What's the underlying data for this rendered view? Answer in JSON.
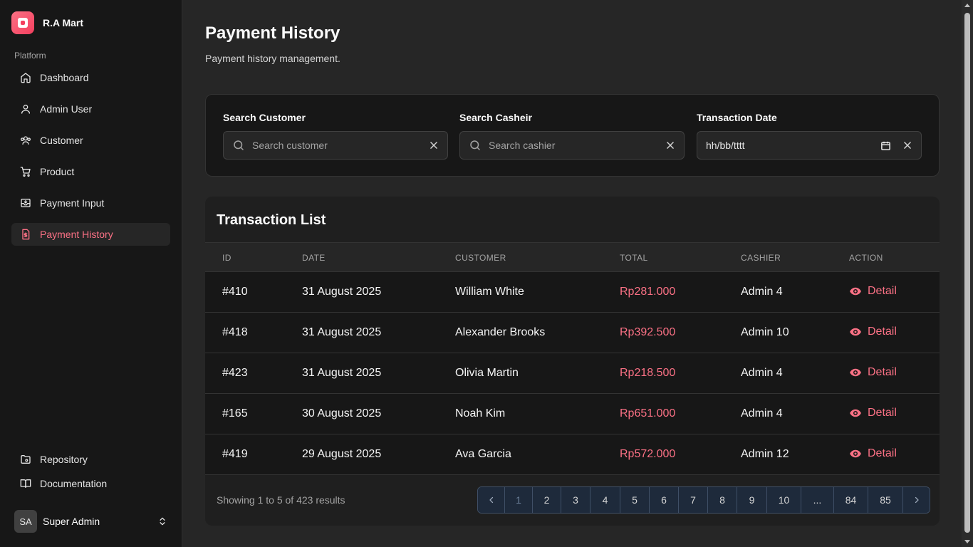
{
  "brand": {
    "name": "R.A Mart",
    "accent": "#fb7185"
  },
  "sidebar": {
    "section_label": "Platform",
    "items": [
      {
        "label": "Dashboard",
        "icon": "home-icon"
      },
      {
        "label": "Admin User",
        "icon": "user-icon"
      },
      {
        "label": "Customer",
        "icon": "users-icon"
      },
      {
        "label": "Product",
        "icon": "cart-icon"
      },
      {
        "label": "Payment Input",
        "icon": "inbox-icon"
      },
      {
        "label": "Payment History",
        "icon": "receipt-icon",
        "active": true
      }
    ],
    "bottom_links": [
      {
        "label": "Repository",
        "icon": "folder-git-icon"
      },
      {
        "label": "Documentation",
        "icon": "book-icon"
      }
    ],
    "user": {
      "initials": "SA",
      "name": "Super Admin"
    }
  },
  "page": {
    "title": "Payment History",
    "subtitle": "Payment history management."
  },
  "filters": {
    "customer": {
      "label": "Search Customer",
      "placeholder": "Search customer"
    },
    "cashier": {
      "label": "Search Casheir",
      "placeholder": "Search cashier"
    },
    "date": {
      "label": "Transaction Date",
      "value": "hh/bb/tttt"
    }
  },
  "table": {
    "title": "Transaction List",
    "columns": [
      "ID",
      "DATE",
      "CUSTOMER",
      "TOTAL",
      "CASHIER",
      "ACTION"
    ],
    "rows": [
      {
        "id": "#410",
        "date": "31 August 2025",
        "customer": "William White",
        "total": "Rp281.000",
        "cashier": "Admin 4",
        "action": "Detail"
      },
      {
        "id": "#418",
        "date": "31 August 2025",
        "customer": "Alexander Brooks",
        "total": "Rp392.500",
        "cashier": "Admin 10",
        "action": "Detail"
      },
      {
        "id": "#423",
        "date": "31 August 2025",
        "customer": "Olivia Martin",
        "total": "Rp218.500",
        "cashier": "Admin 4",
        "action": "Detail"
      },
      {
        "id": "#165",
        "date": "30 August 2025",
        "customer": "Noah Kim",
        "total": "Rp651.000",
        "cashier": "Admin 4",
        "action": "Detail"
      },
      {
        "id": "#419",
        "date": "29 August 2025",
        "customer": "Ava Garcia",
        "total": "Rp572.000",
        "cashier": "Admin 12",
        "action": "Detail"
      }
    ],
    "showing": "Showing 1 to 5 of 423 results",
    "pagination": {
      "prev": "‹",
      "pages": [
        "1",
        "2",
        "3",
        "4",
        "5",
        "6",
        "7",
        "8",
        "9",
        "10",
        "...",
        "84",
        "85"
      ],
      "current": "1",
      "next": "›"
    }
  }
}
